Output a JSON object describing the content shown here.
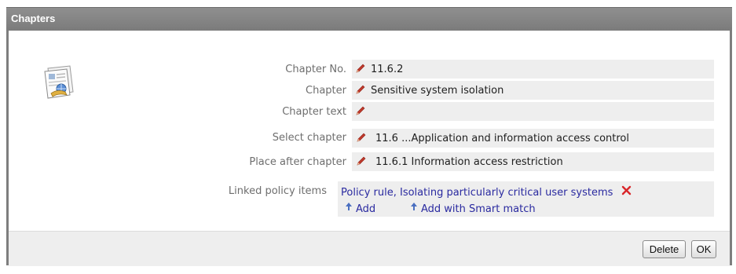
{
  "window": {
    "title": "Chapters"
  },
  "fields": [
    {
      "label": "Chapter No.",
      "value": "11.6.2"
    },
    {
      "label": "Chapter",
      "value": "Sensitive system isolation"
    },
    {
      "label": "Chapter text",
      "value": ""
    },
    {
      "label": "Select chapter",
      "value": "11.6 ...Application and information access control"
    },
    {
      "label": "Place after chapter",
      "value": "11.6.1 Information access restriction"
    }
  ],
  "linked_policy": {
    "label": "Linked policy items",
    "item": "Policy rule, Isolating particularly critical user systems",
    "add_label": "Add",
    "smart_match_label": "Add with Smart match"
  },
  "buttons": {
    "delete": "Delete",
    "ok": "OK"
  },
  "icons": {
    "document": "document-icon",
    "edit": "pencil-icon",
    "remove": "remove-icon",
    "add": "arrow-up-icon"
  },
  "colors": {
    "titlebar": "#858585",
    "field_background": "#eeeeee",
    "link": "#2a2aa0",
    "pencil": "#c0392b",
    "remove": "#d9262a"
  }
}
